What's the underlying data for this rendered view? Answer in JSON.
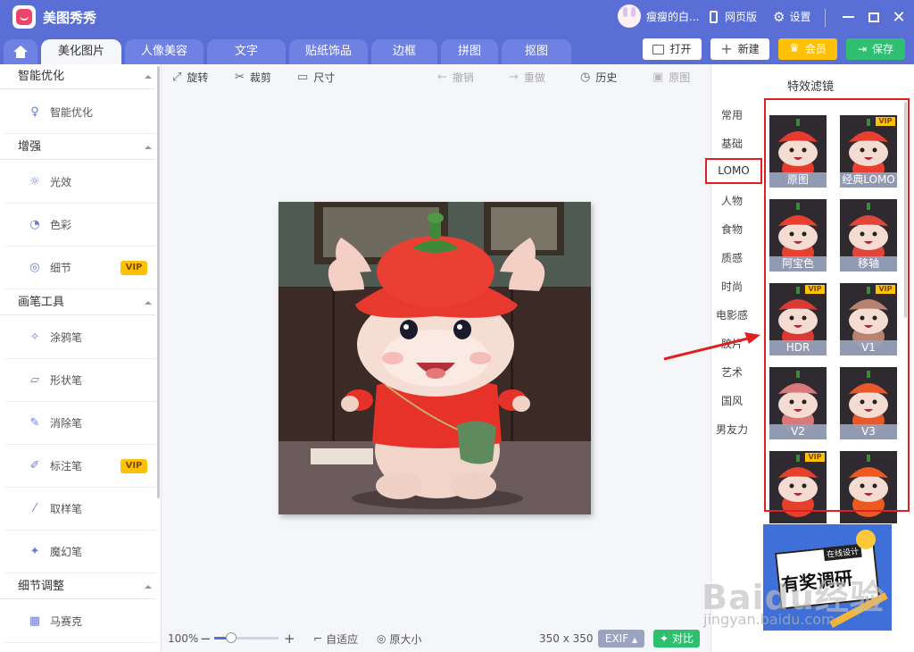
{
  "app": {
    "title": "美图秀秀",
    "user_name": "瘦瘦的白...",
    "web_label": "网页版",
    "settings_label": "设置"
  },
  "tabs": [
    {
      "label": "美化图片",
      "active": true
    },
    {
      "label": "人像美容"
    },
    {
      "label": "文字"
    },
    {
      "label": "贴纸饰品"
    },
    {
      "label": "边框"
    },
    {
      "label": "拼图"
    },
    {
      "label": "抠图"
    }
  ],
  "top_actions": {
    "open": "打开",
    "new": "新建",
    "member": "会员",
    "save": "保存"
  },
  "sidebar": {
    "sections": [
      "智能优化",
      "增强",
      "画笔工具",
      "细节调整"
    ],
    "items": [
      {
        "label": "智能优化",
        "icon": "bulb-icon"
      },
      {
        "label": "光效",
        "icon": "sun-icon"
      },
      {
        "label": "色彩",
        "icon": "palette-icon"
      },
      {
        "label": "细节",
        "icon": "magnifier-icon",
        "vip": "VIP"
      },
      {
        "label": "涂鸦笔",
        "icon": "brush-icon"
      },
      {
        "label": "形状笔",
        "icon": "shape-icon"
      },
      {
        "label": "消除笔",
        "icon": "eraser-icon"
      },
      {
        "label": "标注笔",
        "icon": "pen-icon",
        "vip": "VIP"
      },
      {
        "label": "取样笔",
        "icon": "dropper-icon"
      },
      {
        "label": "魔幻笔",
        "icon": "wand-icon"
      },
      {
        "label": "马赛克",
        "icon": "mosaic-icon"
      }
    ]
  },
  "toolbar": {
    "rotate": "旋转",
    "crop": "裁剪",
    "size": "尺寸",
    "undo": "撤销",
    "redo": "重做",
    "history": "历史",
    "original": "原图"
  },
  "bottom": {
    "zoom": "100%",
    "fit": "自适应",
    "original_size": "原大小",
    "dimensions": "350 x 350",
    "exif": "EXIF",
    "compare": "对比"
  },
  "panel": {
    "title": "特效滤镜",
    "categories": [
      "常用",
      "基础",
      "LOMO",
      "人物",
      "食物",
      "质感",
      "时尚",
      "电影感",
      "胶片",
      "艺术",
      "国风",
      "男友力"
    ],
    "selected_category": "LOMO",
    "filters": [
      {
        "label": "原图",
        "vip": ""
      },
      {
        "label": "经典LOMO",
        "vip": "VIP"
      },
      {
        "label": "阿宝色",
        "vip": ""
      },
      {
        "label": "移轴",
        "vip": ""
      },
      {
        "label": "HDR",
        "vip": "VIP"
      },
      {
        "label": "V1",
        "vip": "VIP"
      },
      {
        "label": "V2",
        "vip": ""
      },
      {
        "label": "V3",
        "vip": ""
      },
      {
        "label": "",
        "vip": "VIP"
      },
      {
        "label": "",
        "vip": ""
      }
    ]
  },
  "ad": {
    "tag": "在线设计",
    "title": "有奖调研"
  },
  "watermark": {
    "brand": "Baidu经验",
    "url": "jingyan.baidu.com"
  },
  "colors": {
    "accent": "#5a6fd6",
    "vip": "#ffc107",
    "save": "#2fbf71",
    "highlight": "#e02020"
  }
}
